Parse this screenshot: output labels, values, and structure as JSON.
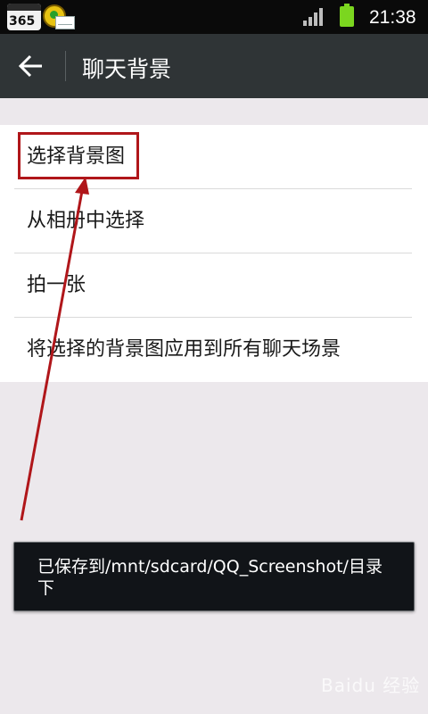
{
  "status_bar": {
    "app_badge": "365",
    "time": "21:38"
  },
  "header": {
    "title": "聊天背景"
  },
  "list": {
    "items": [
      {
        "label": "选择背景图"
      },
      {
        "label": "从相册中选择"
      },
      {
        "label": "拍一张"
      },
      {
        "label": "将选择的背景图应用到所有聊天场景"
      }
    ]
  },
  "toast": {
    "message": "已保存到/mnt/sdcard/QQ_Screenshot/目录下"
  },
  "watermark": {
    "text": "Baidu 经验"
  },
  "colors": {
    "titlebar": "#2f3436",
    "background": "#ece8ec",
    "annotation": "#b0161a",
    "battery": "#7bd61f"
  }
}
